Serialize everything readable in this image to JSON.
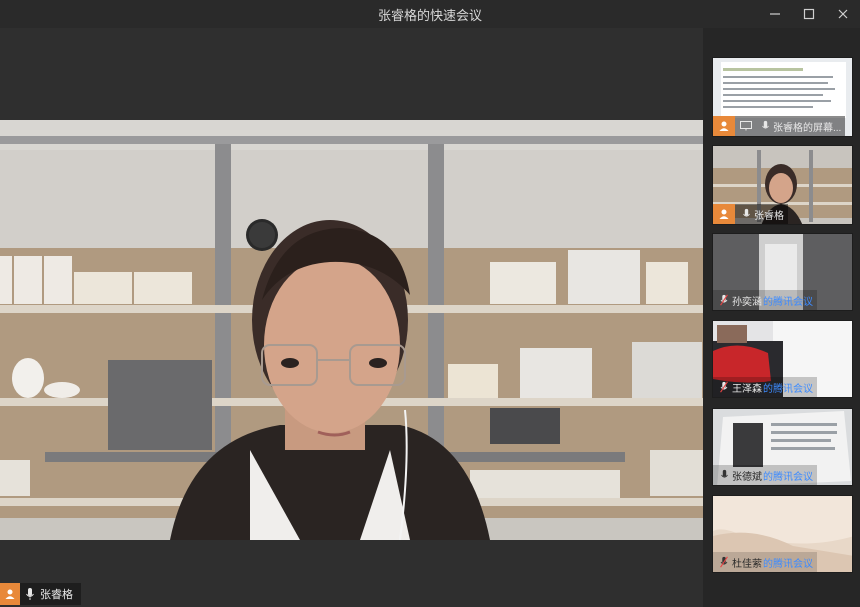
{
  "window": {
    "title": "张睿格的快速会议",
    "controls": [
      "minimize-icon",
      "maximize-icon",
      "close-icon"
    ]
  },
  "main": {
    "speaker_name": "张睿格"
  },
  "sidebar": {
    "participants": [
      {
        "name": "张睿格的屏幕...",
        "suffix": ""
      },
      {
        "name": "张睿格",
        "suffix": ""
      },
      {
        "name": "孙奕涵",
        "suffix": "的腾讯会议"
      },
      {
        "name": "王泽森",
        "suffix": "的腾讯会议"
      },
      {
        "name": "张德斌",
        "suffix": "的腾讯会议"
      },
      {
        "name": "杜佳萦",
        "suffix": "的腾讯会议"
      }
    ]
  },
  "colors": {
    "accent_orange": "#e8893a",
    "link_blue": "#3d8bff",
    "background": "#2e2e2e"
  }
}
